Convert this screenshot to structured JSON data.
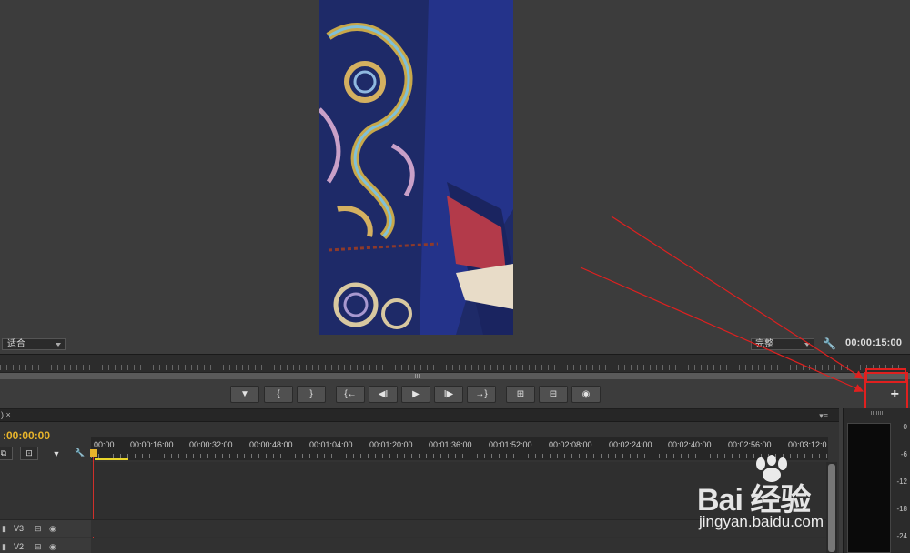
{
  "monitor": {
    "fit_select": "适合",
    "quality_select": "完整",
    "timecode": "00:00:15:00"
  },
  "transport": {
    "buttons": [
      {
        "name": "add-marker-button",
        "glyph": "▼"
      },
      {
        "name": "mark-in-button",
        "glyph": "{"
      },
      {
        "name": "mark-out-button",
        "glyph": "}"
      },
      {
        "name": "go-to-in-button",
        "glyph": "{←"
      },
      {
        "name": "step-back-button",
        "glyph": "◀I"
      },
      {
        "name": "play-button",
        "glyph": "▶"
      },
      {
        "name": "step-forward-button",
        "glyph": "I▶"
      },
      {
        "name": "go-to-out-button",
        "glyph": "→}"
      },
      {
        "name": "lift-button",
        "glyph": "⊞"
      },
      {
        "name": "extract-button",
        "glyph": "⊟"
      },
      {
        "name": "export-frame-button",
        "glyph": "◉"
      }
    ],
    "plus_label": "+"
  },
  "timeline": {
    "tab_label": ") ×",
    "panel_menu": "▾≡",
    "timecode": ":00:00:00",
    "ruler_labels": [
      "00:00",
      "00:00:16:00",
      "00:00:32:00",
      "00:00:48:00",
      "00:01:04:00",
      "00:01:20:00",
      "00:01:36:00",
      "00:01:52:00",
      "00:02:08:00",
      "00:02:24:00",
      "00:02:40:00",
      "00:02:56:00",
      "00:03:12:0"
    ],
    "tracks": [
      {
        "label": "V3"
      },
      {
        "label": "V2"
      }
    ]
  },
  "meters": {
    "scale": [
      "0",
      "-6",
      "-12",
      "-18",
      "-24"
    ]
  },
  "watermark": {
    "brand": "Bai 经验",
    "url": "jingyan.baidu.com"
  }
}
